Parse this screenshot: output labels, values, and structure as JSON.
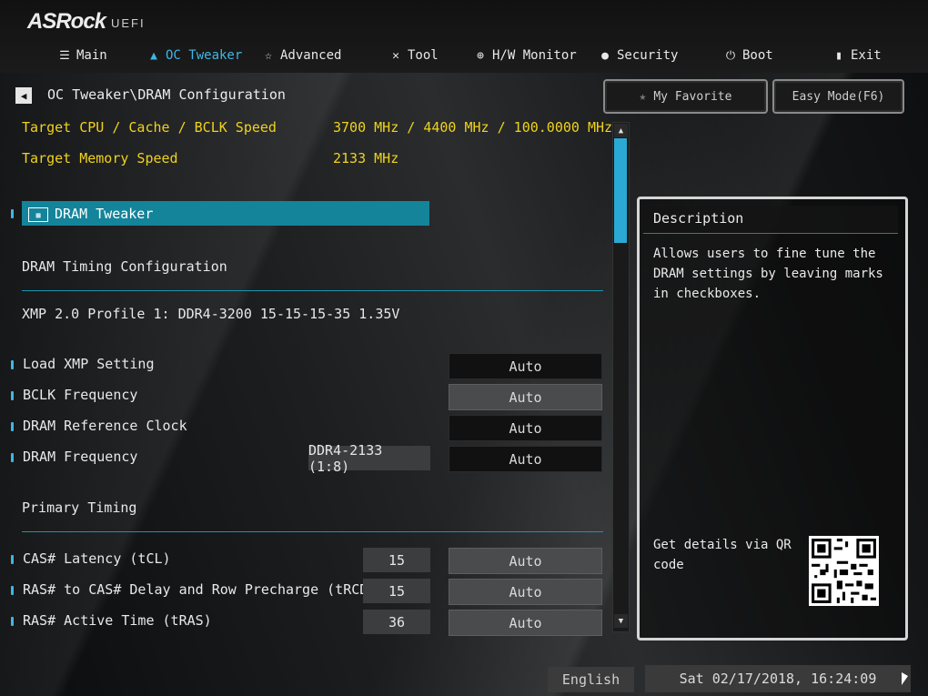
{
  "brand": {
    "logo": "ASRock",
    "sub": "UEFI"
  },
  "nav": [
    {
      "label": "Main",
      "icon": "list-icon"
    },
    {
      "label": "OC Tweaker",
      "icon": "flame-icon"
    },
    {
      "label": "Advanced",
      "icon": "star-icon"
    },
    {
      "label": "Tool",
      "icon": "tools-icon"
    },
    {
      "label": "H/W Monitor",
      "icon": "monitor-icon"
    },
    {
      "label": "Security",
      "icon": "shield-icon"
    },
    {
      "label": "Boot",
      "icon": "power-icon"
    },
    {
      "label": "Exit",
      "icon": "exit-icon"
    }
  ],
  "breadcrumb": "OC Tweaker\\DRAM Configuration",
  "buttons": {
    "favorite": "My Favorite",
    "easy_mode": "Easy Mode(F6)"
  },
  "info": {
    "cpu_label": "Target CPU / Cache / BCLK Speed",
    "cpu_value": "3700 MHz / 4400 MHz / 100.0000 MHz",
    "mem_label": "Target Memory Speed",
    "mem_value": "2133 MHz"
  },
  "selected_item": "DRAM Tweaker",
  "sections": {
    "timing_config": "DRAM Timing Configuration",
    "xmp_profile": "XMP 2.0 Profile 1: DDR4-3200 15-15-15-35 1.35V",
    "primary_timing": "Primary Timing"
  },
  "settings": [
    {
      "label": "Load XMP Setting",
      "current": "",
      "value": "Auto",
      "style": "dark"
    },
    {
      "label": "BCLK Frequency",
      "current": "",
      "value": "Auto",
      "style": "gray"
    },
    {
      "label": "DRAM Reference Clock",
      "current": "",
      "value": "Auto",
      "style": "dark"
    },
    {
      "label": "DRAM Frequency",
      "current": "DDR4-2133 (1:8)",
      "value": "Auto",
      "style": "dark"
    },
    {
      "label": "CAS# Latency (tCL)",
      "current": "15",
      "value": "Auto",
      "style": "gray"
    },
    {
      "label": "RAS# to CAS# Delay and Row Precharge (tRCDtRP)",
      "current": "15",
      "value": "Auto",
      "style": "gray"
    },
    {
      "label": "RAS# Active Time (tRAS)",
      "current": "36",
      "value": "Auto",
      "style": "gray"
    }
  ],
  "description": {
    "title": "Description",
    "text": "Allows users to fine tune the DRAM settings by leaving marks in checkboxes.",
    "qr_text": "Get details via QR code"
  },
  "status": {
    "language": "English",
    "datetime": "Sat 02/17/2018, 16:24:09"
  },
  "colors": {
    "accent": "#2aa9d4",
    "highlight": "#14849a",
    "info_text": "#f0d21c"
  }
}
